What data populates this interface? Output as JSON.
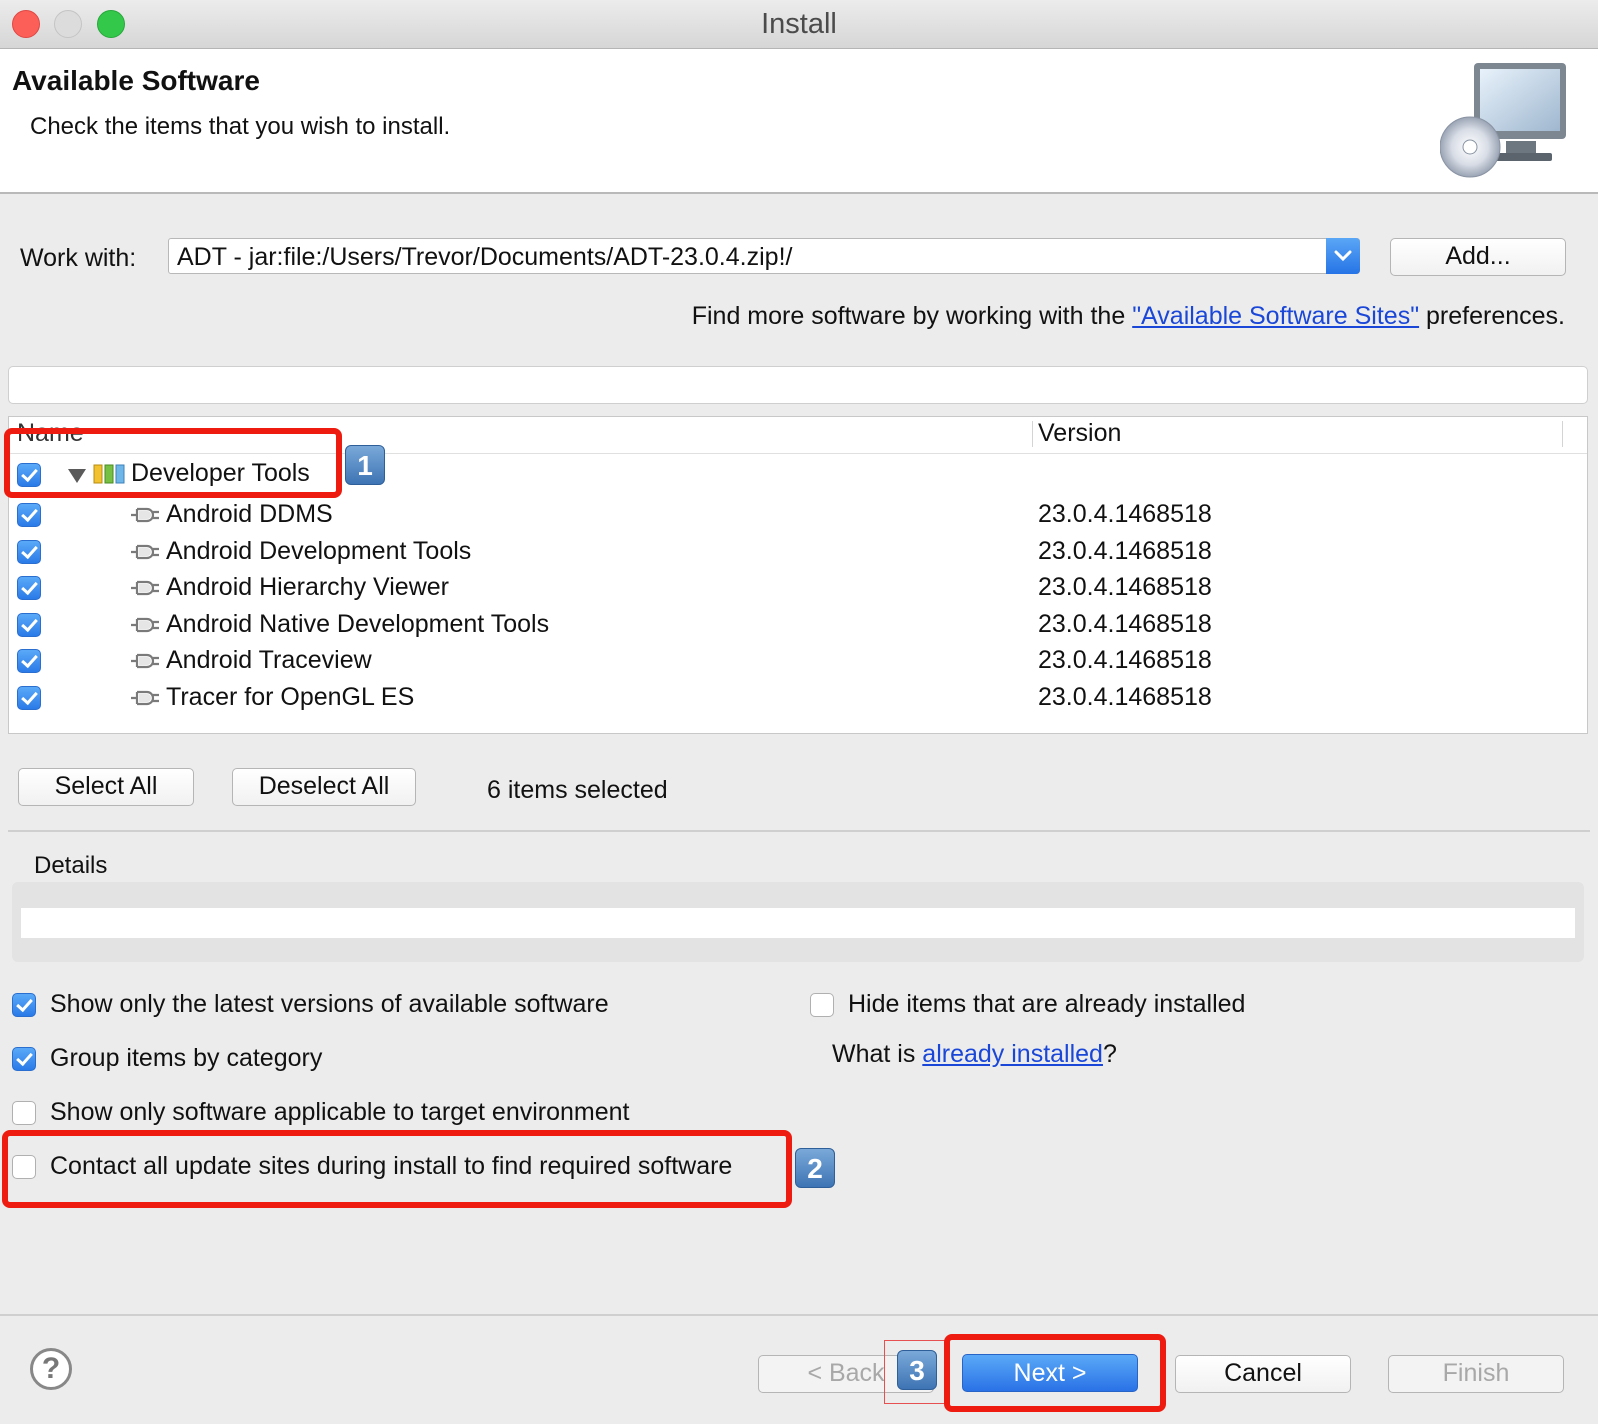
{
  "window": {
    "title": "Install"
  },
  "header": {
    "title": "Available Software",
    "subtitle": "Check the items that you wish to install."
  },
  "work_with": {
    "label": "Work with:",
    "value": "ADT - jar:file:/Users/Trevor/Documents/ADT-23.0.4.zip!/",
    "add_button": "Add..."
  },
  "find_more": {
    "prefix": "Find more software by working with the ",
    "link": "\"Available Software Sites\"",
    "suffix": " preferences."
  },
  "table": {
    "col_name": "Name",
    "col_version": "Version",
    "category": {
      "label": "Developer Tools",
      "checked": true
    },
    "rows": [
      {
        "name": "Android DDMS",
        "version": "23.0.4.1468518",
        "checked": true
      },
      {
        "name": "Android Development Tools",
        "version": "23.0.4.1468518",
        "checked": true
      },
      {
        "name": "Android Hierarchy Viewer",
        "version": "23.0.4.1468518",
        "checked": true
      },
      {
        "name": "Android Native Development Tools",
        "version": "23.0.4.1468518",
        "checked": true
      },
      {
        "name": "Android Traceview",
        "version": "23.0.4.1468518",
        "checked": true
      },
      {
        "name": "Tracer for OpenGL ES",
        "version": "23.0.4.1468518",
        "checked": true
      }
    ]
  },
  "selection": {
    "select_all": "Select All",
    "deselect_all": "Deselect All",
    "count_text": "6 items selected"
  },
  "details": {
    "label": "Details"
  },
  "options": {
    "latest_versions": {
      "label": "Show only the latest versions of available software",
      "checked": true
    },
    "group_by_category": {
      "label": "Group items by category",
      "checked": true
    },
    "target_env": {
      "label": "Show only software applicable to target environment",
      "checked": false
    },
    "contact_sites": {
      "label": "Contact all update sites during install to find required software",
      "checked": false
    },
    "hide_installed": {
      "label": "Hide items that are already installed",
      "checked": false
    },
    "what_is_prefix": "What is ",
    "already_installed_link": "already installed",
    "what_is_suffix": "?"
  },
  "annotations": {
    "badge1": "1",
    "badge2": "2",
    "badge3": "3"
  },
  "footer": {
    "back": "< Back",
    "next": "Next >",
    "cancel": "Cancel",
    "finish": "Finish",
    "help": "?"
  },
  "colors": {
    "accent_blue": "#2a7ae8",
    "highlight_red": "#ee1c10",
    "link_blue": "#1a47d8"
  }
}
